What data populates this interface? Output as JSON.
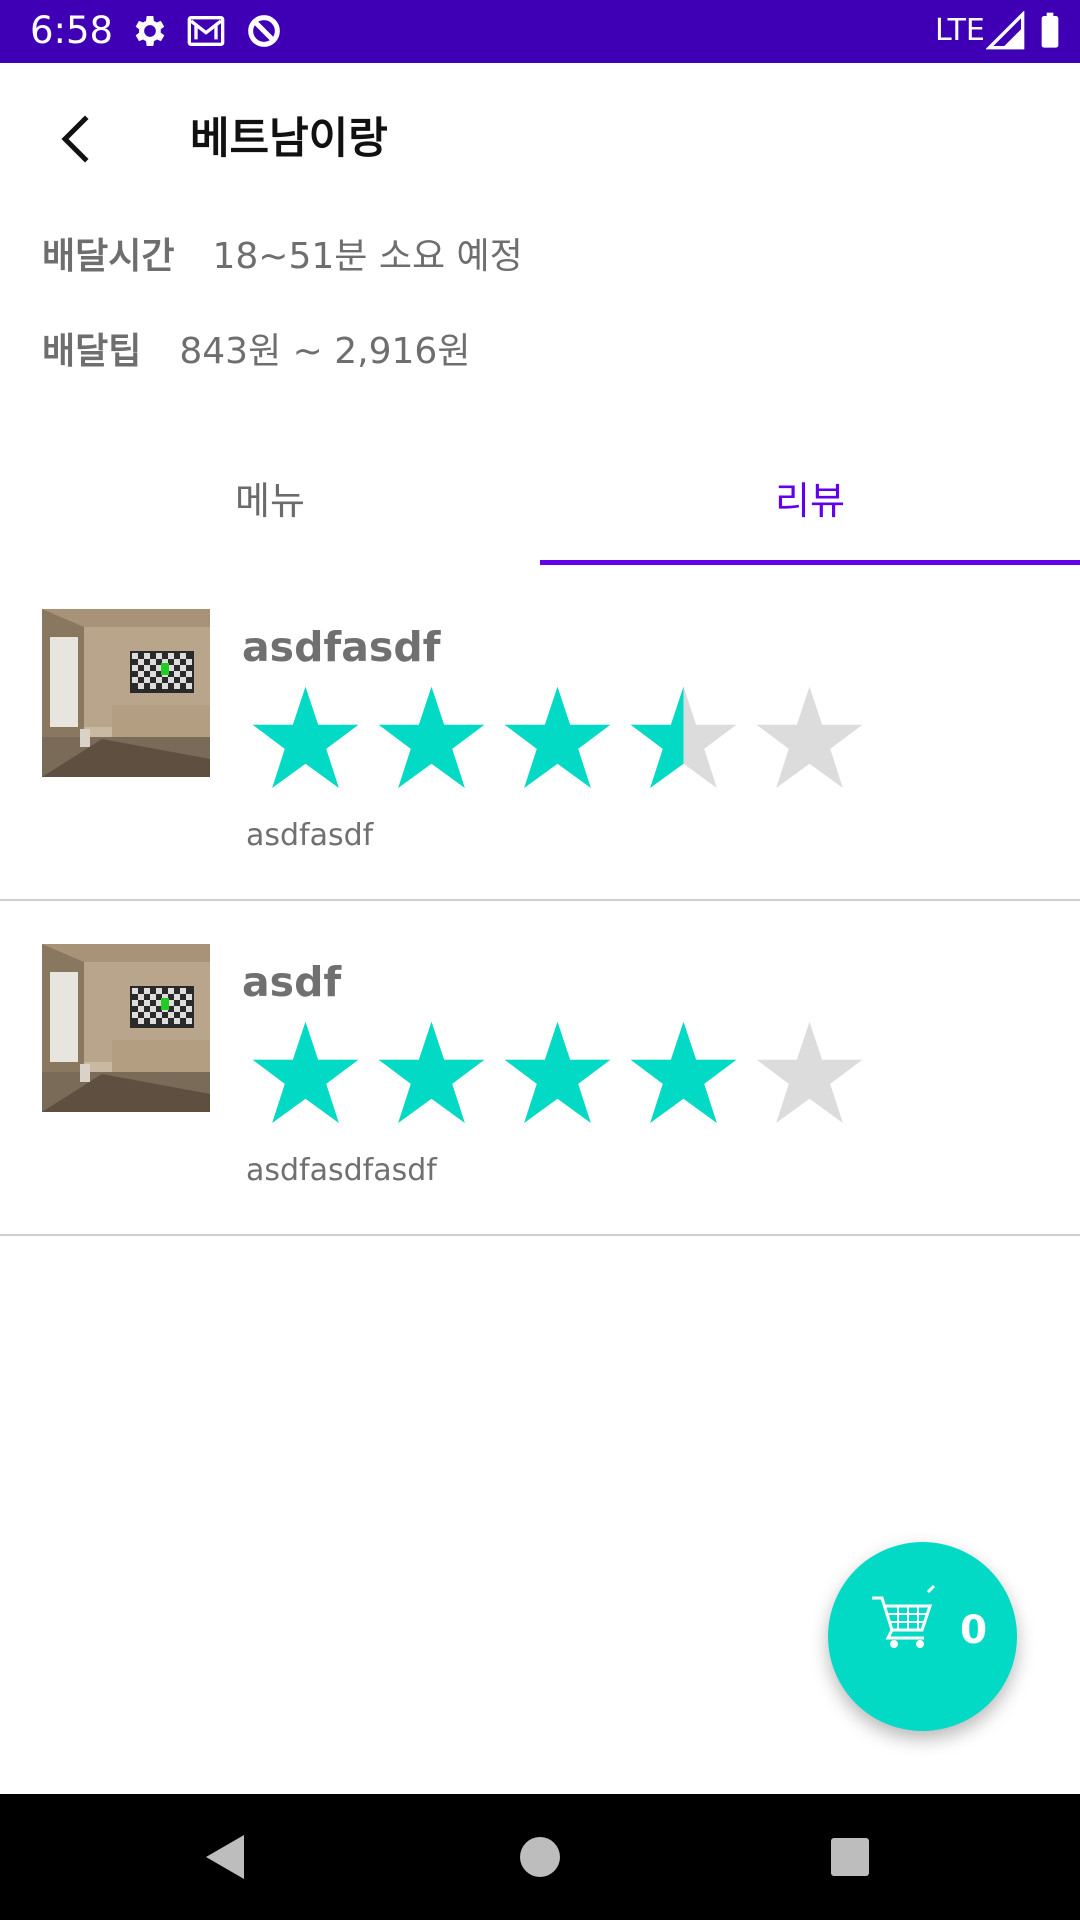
{
  "status_bar": {
    "time": "6:58",
    "network": "LTE",
    "icons": [
      "gear-icon",
      "gmail-icon",
      "data-saver-icon",
      "signal-icon",
      "battery-icon"
    ]
  },
  "header": {
    "title": "베트남이랑",
    "back_icon": "back-arrow-icon"
  },
  "delivery": {
    "time_label": "배달시간",
    "time_value": "18~51분 소요 예정",
    "tip_label": "배달팁",
    "tip_value": "843원 ~ 2,916원"
  },
  "tabs": [
    {
      "label": "메뉴",
      "selected": false
    },
    {
      "label": "리뷰",
      "selected": true
    }
  ],
  "reviews": [
    {
      "name": "asdfasdf",
      "rating": 3.5,
      "max": 5,
      "comment": "asdfasdf"
    },
    {
      "name": "asdf",
      "rating": 4,
      "max": 5,
      "comment": "asdfasdfasdf"
    }
  ],
  "cart": {
    "count": "0",
    "icon": "cart-icon"
  },
  "colors": {
    "status_bar": "#3f00b5",
    "accent": "#6200ea",
    "teal": "#03dac5",
    "star_filled": "#03dac5",
    "star_empty": "#dcdcdc"
  },
  "nav_bar": {
    "icons": [
      "back-triangle-icon",
      "home-circle-icon",
      "recents-square-icon"
    ]
  }
}
